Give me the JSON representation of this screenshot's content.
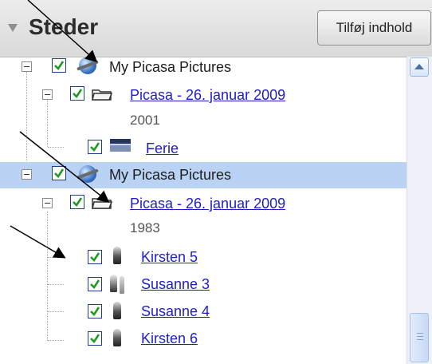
{
  "panel": {
    "title": "Steder",
    "add_button": "Tilføj indhold"
  },
  "tree": [
    {
      "label": "My Picasa Pictures",
      "kind": "root",
      "icon": "globe-icon",
      "selected": false
    },
    {
      "label": "Picasa - 26. januar 2009",
      "kind": "folder",
      "icon": "folder-icon",
      "count": "2001"
    },
    {
      "label": "Ferie",
      "kind": "album",
      "icon": "landscape-thumbnail-icon"
    },
    {
      "label": "My Picasa Pictures",
      "kind": "root",
      "icon": "globe-icon",
      "selected": true
    },
    {
      "label": "Picasa - 26. januar 2009",
      "kind": "folder",
      "icon": "folder-icon",
      "count": "1983"
    },
    {
      "label": "Kirsten 5",
      "kind": "album",
      "icon": "portrait-thumbnail-icon"
    },
    {
      "label": "Susanne 3",
      "kind": "album",
      "icon": "portrait-thumbnail-icon"
    },
    {
      "label": "Susanne 4",
      "kind": "album",
      "icon": "portrait-thumbnail-icon"
    },
    {
      "label": "Kirsten 6",
      "kind": "album",
      "icon": "portrait-thumbnail-icon"
    }
  ],
  "colors": {
    "selection": "#bad3f5",
    "link": "#1e1ec8",
    "checkmark": "#1f9a1f"
  }
}
